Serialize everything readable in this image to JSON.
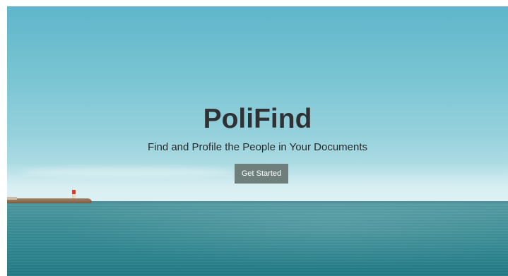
{
  "hero": {
    "title": "PoliFind",
    "subtitle": "Find and Profile the People in Your Documents",
    "cta_label": "Get Started"
  },
  "colors": {
    "title_text": "#2f3234",
    "cta_background": "#6f7f7c",
    "cta_text": "#ffffff",
    "sky": "#78c4d3",
    "sea": "#2f8690"
  }
}
